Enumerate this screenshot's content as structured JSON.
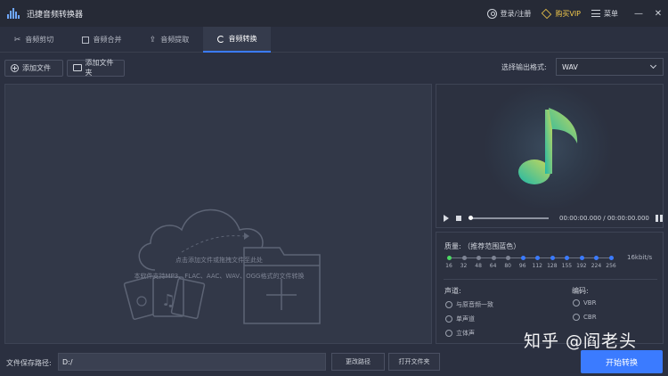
{
  "app": {
    "title": "迅捷音频转换器"
  },
  "header": {
    "login": "登录/注册",
    "vip": "购买VIP",
    "menu": "菜单"
  },
  "tabs": [
    {
      "label": "音频剪切"
    },
    {
      "label": "音频合并"
    },
    {
      "label": "音频提取"
    },
    {
      "label": "音频转换"
    }
  ],
  "toolbar": {
    "add_file": "添加文件",
    "add_folder": "添加文件夹",
    "format_label": "选择输出格式:",
    "format_value": "WAV"
  },
  "drop": {
    "hint": "点击添加文件或拖拽文件至此处",
    "support": "本软件支持MP3、FLAC、AAC、WAV、OGG格式的文件转换"
  },
  "player": {
    "time": "00:00:00.000 / 00:00:00.000"
  },
  "settings": {
    "quality_label": "质量: （推荐范围蓝色）",
    "quality_unit": "16kbit/s",
    "quality_ticks": [
      "16",
      "32",
      "48",
      "64",
      "80",
      "96",
      "112",
      "128",
      "155",
      "192",
      "224",
      "256"
    ],
    "selected_quality": "16",
    "channel_label": "声道:",
    "channel_options": [
      "与原音频一致",
      "单声道",
      "立体声"
    ],
    "encode_label": "编码:",
    "encode_options": [
      "VBR",
      "CBR"
    ]
  },
  "bottom": {
    "path_label": "文件保存路径:",
    "path_value": "D:/",
    "change_path": "更改路径",
    "open_folder": "打开文件夹",
    "start": "开始转换"
  },
  "watermark": "知乎 @阎老头",
  "colors": {
    "accent": "#3b7bff",
    "vip": "#f2c94c",
    "selected_dot": "#4cd964"
  }
}
